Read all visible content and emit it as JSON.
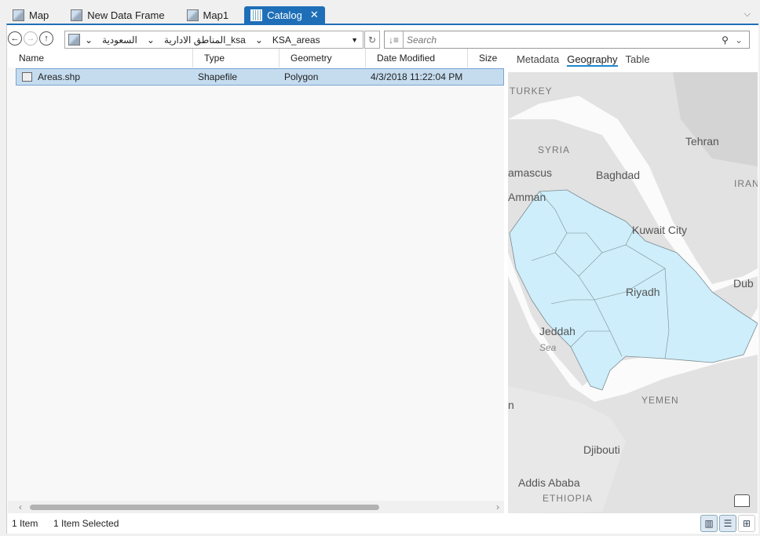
{
  "tabs": [
    {
      "label": "Map",
      "icon": "map-icon"
    },
    {
      "label": "New Data Frame",
      "icon": "map-icon"
    },
    {
      "label": "Map1",
      "icon": "map-icon"
    },
    {
      "label": "Catalog",
      "icon": "catalog-icon",
      "close": "✕"
    }
  ],
  "path": {
    "segments": [
      "السعودية",
      "ksa_المناطق الادارية",
      "KSA_areas"
    ]
  },
  "search": {
    "placeholder": "Search"
  },
  "columns": [
    "Name",
    "Type",
    "Geometry",
    "Date Modified",
    "Size"
  ],
  "rows": [
    {
      "name": "Areas.shp",
      "type": "Shapefile",
      "geometry": "Polygon",
      "date": "4/3/2018 11:22:04 PM",
      "size": ""
    }
  ],
  "status": {
    "count": "1 Item",
    "selected": "1 Item Selected"
  },
  "preview_tabs": [
    "Metadata",
    "Geography",
    "Table"
  ],
  "active_preview_tab": "Geography",
  "map_labels": {
    "turkey": "TURKEY",
    "syria": "SYRIA",
    "damascus": "amascus",
    "amman": "Amman",
    "baghdad": "Baghdad",
    "tehran": "Tehran",
    "iran": "IRAN",
    "kuwait": "Kuwait City",
    "dubai": "Dub",
    "riyadh": "Riyadh",
    "jeddah": "Jeddah",
    "sea": "Sea",
    "yemen": "YEMEN",
    "djibouti": "Djibouti",
    "addis": "Addis Ababa",
    "ethiopia": "ETHIOPIA",
    "n": "n"
  },
  "colors": {
    "accent": "#1f6fb8",
    "selection": "#c5dcef",
    "ksa_fill": "#cdeefa"
  }
}
